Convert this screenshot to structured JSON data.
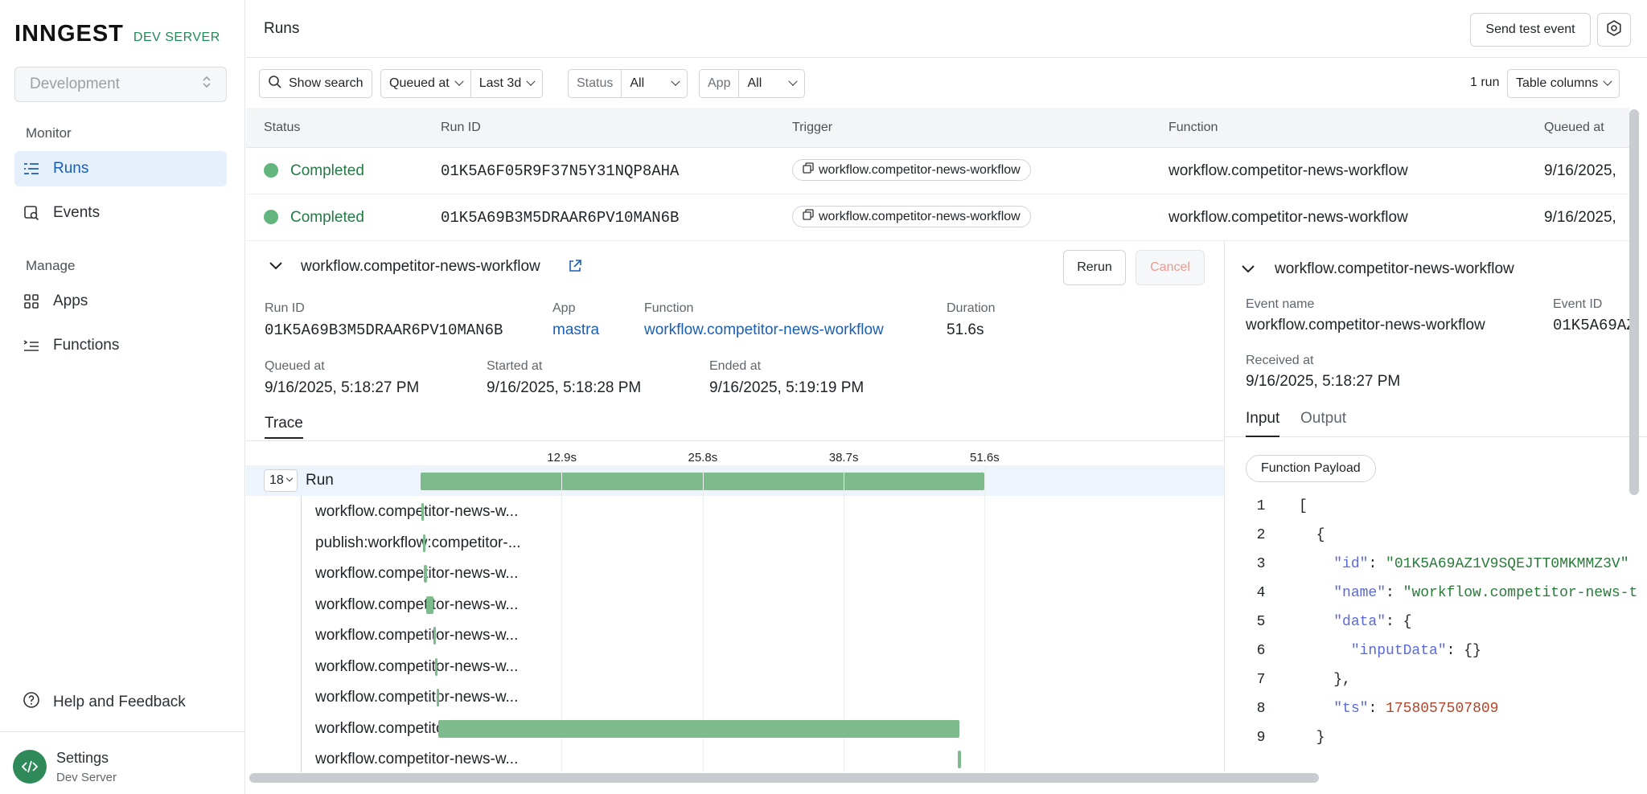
{
  "sidebar": {
    "logo": "INNGEST",
    "logo_sub": "DEV SERVER",
    "env": "Development",
    "sections": {
      "monitor": "Monitor",
      "manage": "Manage"
    },
    "items": [
      {
        "label": "Runs",
        "icon": "runs-icon"
      },
      {
        "label": "Events",
        "icon": "events-icon"
      },
      {
        "label": "Apps",
        "icon": "apps-icon"
      },
      {
        "label": "Functions",
        "icon": "functions-icon"
      }
    ],
    "help": "Help and Feedback",
    "footer": {
      "title": "Settings",
      "sub": "Dev Server"
    }
  },
  "header": {
    "title": "Runs",
    "send_test_event": "Send test event"
  },
  "filters": {
    "show_search": "Show search",
    "queued_at": "Queued at",
    "range": "Last 3d",
    "status_label": "Status",
    "status_value": "All",
    "app_label": "App",
    "app_value": "All",
    "count": "1 run",
    "table_columns": "Table columns"
  },
  "table": {
    "headers": [
      "Status",
      "Run ID",
      "Trigger",
      "Function",
      "Queued at"
    ],
    "rows": [
      {
        "status": "Completed",
        "run_id": "01K5A6F05R9F37N5Y31NQP8AHA",
        "trigger": "workflow.competitor-news-workflow",
        "function": "workflow.competitor-news-workflow",
        "queued": "9/16/2025,"
      },
      {
        "status": "Completed",
        "run_id": "01K5A69B3M5DRAAR6PV10MAN6B",
        "trigger": "workflow.competitor-news-workflow",
        "function": "workflow.competitor-news-workflow",
        "queued": "9/16/2025,"
      }
    ]
  },
  "detail": {
    "title": "workflow.competitor-news-workflow",
    "rerun": "Rerun",
    "cancel": "Cancel",
    "run_id_label": "Run ID",
    "run_id": "01K5A69B3M5DRAAR6PV10MAN6B",
    "app_label": "App",
    "app": "mastra",
    "function_label": "Function",
    "function": "workflow.competitor-news-workflow",
    "duration_label": "Duration",
    "duration": "51.6s",
    "queued_label": "Queued at",
    "queued": "9/16/2025, 5:18:27 PM",
    "started_label": "Started at",
    "started": "9/16/2025, 5:18:28 PM",
    "ended_label": "Ended at",
    "ended": "9/16/2025, 5:19:19 PM",
    "trace_tab": "Trace"
  },
  "trace": {
    "total_seconds": 51.6,
    "ticks": [
      "12.9s",
      "25.8s",
      "38.7s",
      "51.6s"
    ],
    "span_count": "18",
    "run_label": "Run",
    "run_span": {
      "start": 0,
      "end": 51.6
    },
    "spans": [
      {
        "label": "workflow.competitor-news-w...",
        "start": 0.1,
        "end": 0.3
      },
      {
        "label": "publish:workflow:competitor-...",
        "start": 0.2,
        "end": 0.4
      },
      {
        "label": "workflow.competitor-news-w...",
        "start": 0.3,
        "end": 0.6
      },
      {
        "label": "workflow.competitor-news-w...",
        "start": 0.5,
        "end": 1.2
      },
      {
        "label": "workflow.competitor-news-w...",
        "start": 1.2,
        "end": 1.4
      },
      {
        "label": "workflow.competitor-news-w...",
        "start": 1.3,
        "end": 1.5
      },
      {
        "label": "workflow.competitor-news-w...",
        "start": 1.5,
        "end": 1.7
      },
      {
        "label": "workflow.competitor-news-w...",
        "start": 1.6,
        "end": 49.3
      },
      {
        "label": "workflow.competitor-news-w...",
        "start": 49.2,
        "end": 49.5
      }
    ]
  },
  "event_panel": {
    "title": "workflow.competitor-news-workflow",
    "event_name_label": "Event name",
    "event_name": "workflow.competitor-news-workflow",
    "event_id_label": "Event ID",
    "event_id": "01K5A69AZ",
    "received_label": "Received at",
    "received": "9/16/2025, 5:18:27 PM",
    "tab_input": "Input",
    "tab_output": "Output",
    "payload": "Function Payload",
    "code": [
      {
        "n": "1",
        "t": "["
      },
      {
        "n": "2",
        "t": "  {"
      },
      {
        "n": "3",
        "k": "\"id\"",
        "v": "\"01K5A69AZ1V9SQEJTT0MKMMZ3V\"",
        "indent": "    "
      },
      {
        "n": "4",
        "k": "\"name\"",
        "v": "\"workflow.competitor-news-t",
        "indent": "    "
      },
      {
        "n": "5",
        "k": "\"data\"",
        "v": "{",
        "indent": "    ",
        "plain": true
      },
      {
        "n": "6",
        "k": "\"inputData\"",
        "v": "{}",
        "indent": "      ",
        "plain": true
      },
      {
        "n": "7",
        "t": "    },"
      },
      {
        "n": "8",
        "k": "\"ts\"",
        "v": "1758057507809",
        "indent": "    ",
        "num": true
      },
      {
        "n": "9",
        "t": "  }"
      }
    ]
  }
}
